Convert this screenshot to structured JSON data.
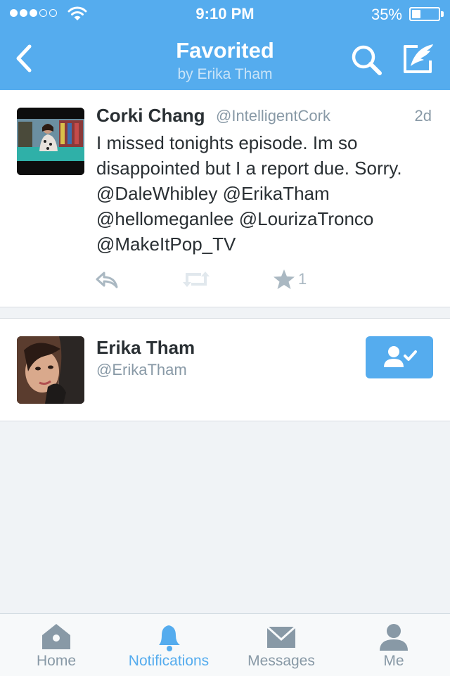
{
  "status_bar": {
    "time": "9:10 PM",
    "battery_percent": "35%",
    "battery_level": 0.35,
    "signal_bars_filled": 3,
    "signal_bars_total": 5
  },
  "header": {
    "title": "Favorited",
    "subtitle": "by Erika Tham"
  },
  "tweet": {
    "name": "Corki Chang",
    "handle": "@IntelligentCork",
    "time": "2d",
    "text": "I missed tonights episode. Im so\ndisappointed but I a report due. Sorry.\n@DaleWhibley @ErikaTham\n@hellomeganlee @LourizaTronco\n@MakeItPop_TV",
    "favorite_count": "1"
  },
  "user": {
    "name": "Erika Tham",
    "handle": "@ErikaTham"
  },
  "tabs": [
    {
      "label": "Home",
      "icon": "home-icon"
    },
    {
      "label": "Notifications",
      "icon": "bell-icon"
    },
    {
      "label": "Messages",
      "icon": "envelope-icon"
    },
    {
      "label": "Me",
      "icon": "person-icon"
    }
  ],
  "colors": {
    "accent": "#55acee",
    "text": "#292f33",
    "muted": "#8899a6",
    "action": "#aab8c2"
  }
}
